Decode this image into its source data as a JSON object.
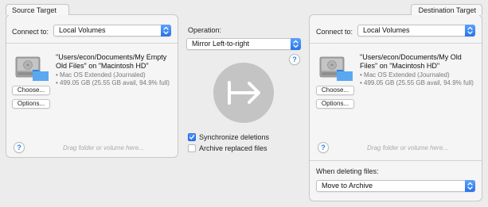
{
  "source": {
    "tab_label": "Source Target",
    "connect_label": "Connect to:",
    "connect_value": "Local Volumes",
    "volume_name": "\"Users/econ/Documents/My Empty Old Files\" on \"Macintosh HD\"",
    "volume_detail": "• Mac OS Extended (Journaled)\n• 499.05 GB (25.55 GB avail, 94.9% full)",
    "choose_label": "Choose...",
    "options_label": "Options...",
    "drag_hint": "Drag folder or volume here...",
    "help_label": "?"
  },
  "operation": {
    "label": "Operation:",
    "value": "Mirror Left-to-right",
    "help_label": "?",
    "sync_deletions_label": "Synchronize deletions",
    "sync_deletions_checked": true,
    "archive_replaced_label": "Archive replaced files",
    "archive_replaced_checked": false
  },
  "destination": {
    "tab_label": "Destination Target",
    "connect_label": "Connect to:",
    "connect_value": "Local Volumes",
    "volume_name": "\"Users/econ/Documents/My Old Files\" on \"Macintosh HD\"",
    "volume_detail": "• Mac OS Extended (Journaled)\n• 499.05 GB (25.55 GB avail, 94.9% full)",
    "choose_label": "Choose...",
    "options_label": "Options...",
    "drag_hint": "Drag folder or volume here...",
    "help_label": "?",
    "deleting_label": "When deleting files:",
    "deleting_value": "Move to Archive"
  },
  "colors": {
    "accent": "#2a72ea",
    "background": "#ececec",
    "panel": "#f5f5f5",
    "direction_circle": "#c4c4c4"
  },
  "icons": {
    "drive": "hard-drive-icon",
    "folder": "folder-icon",
    "direction": "arrow-right-to-bar-icon",
    "popup": "chevron-up-down-icon",
    "check": "checkmark-icon"
  }
}
